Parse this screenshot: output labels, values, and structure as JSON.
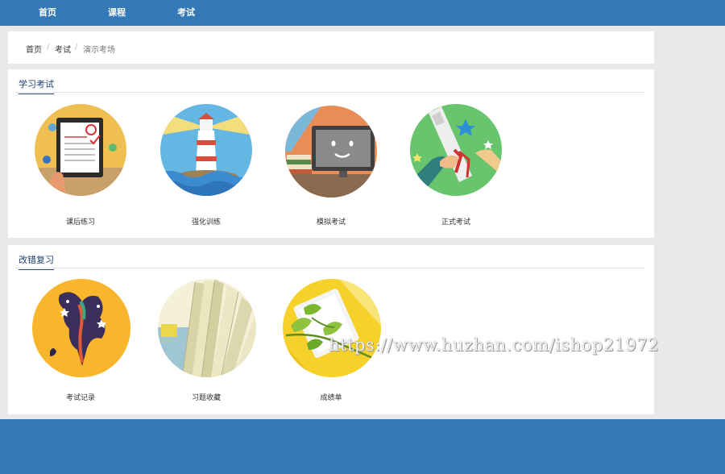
{
  "nav": {
    "items": [
      "首页",
      "课程",
      "考试"
    ]
  },
  "breadcrumb": {
    "home": "首页",
    "sep1": "/",
    "exam": "考试",
    "sep2": "/",
    "current": "演示考场"
  },
  "study_exam": {
    "title": "学习考试",
    "tiles": [
      "课后练习",
      "强化训练",
      "模拟考试",
      "正式考试"
    ]
  },
  "review": {
    "title": "改错复习",
    "tiles": [
      "考试记录",
      "习题收藏",
      "成绩单"
    ]
  },
  "watermark": "https://www.huzhan.com/ishop21972",
  "colors": {
    "brand": "#3479b7",
    "section_title": "#1c3f6e",
    "background": "#e9e9e9"
  },
  "icons": [
    "tablet-homework-icon",
    "lighthouse-icon",
    "monitor-smiley-icon",
    "diploma-handshake-icon",
    "quill-ink-icon",
    "open-book-icon",
    "report-card-icon"
  ]
}
